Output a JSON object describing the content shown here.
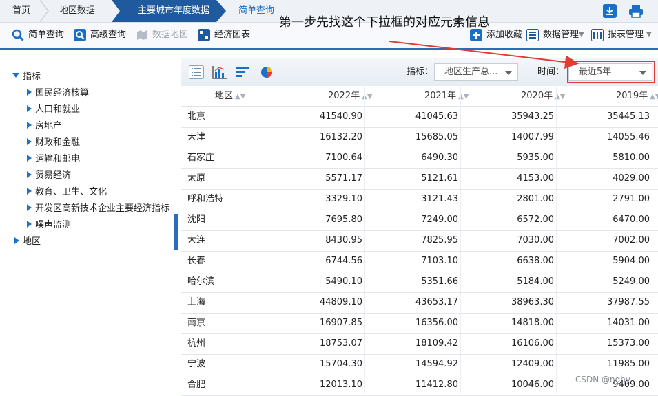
{
  "breadcrumb": {
    "items": [
      "首页",
      "地区数据"
    ],
    "active": "主要城市年度数据",
    "current": "简单查询"
  },
  "toolbar": {
    "simple_query": "简单查询",
    "advanced_query": "高级查询",
    "data_map": "数据地图",
    "economic_chart": "经济图表",
    "add_favorite": "添加收藏",
    "data_manage": "数据管理",
    "report_manage": "报表管理"
  },
  "annotation": "第一步先找这个下拉框的对应元素信息",
  "tree": {
    "root": "指标",
    "children": [
      "国民经济核算",
      "人口和就业",
      "房地产",
      "财政和金融",
      "运输和邮电",
      "贸易经济",
      "教育、卫生、文化",
      "开发区高新技术企业主要经济指标",
      "噪声监测"
    ],
    "second_root": "地区"
  },
  "filters": {
    "indicator_label": "指标：",
    "indicator_value": "地区生产总...",
    "time_label": "时间：",
    "time_value": "最近5年"
  },
  "table": {
    "headers": [
      "地区",
      "2022年",
      "2021年",
      "2020年",
      "2019年"
    ],
    "rows": [
      [
        "北京",
        "41540.90",
        "41045.63",
        "35943.25",
        "35445.13"
      ],
      [
        "天津",
        "16132.20",
        "15685.05",
        "14007.99",
        "14055.46"
      ],
      [
        "石家庄",
        "7100.64",
        "6490.30",
        "5935.00",
        "5810.00"
      ],
      [
        "太原",
        "5571.17",
        "5121.61",
        "4153.00",
        "4029.00"
      ],
      [
        "呼和浩特",
        "3329.10",
        "3121.43",
        "2801.00",
        "2791.00"
      ],
      [
        "沈阳",
        "7695.80",
        "7249.00",
        "6572.00",
        "6470.00"
      ],
      [
        "大连",
        "8430.95",
        "7825.95",
        "7030.00",
        "7002.00"
      ],
      [
        "长春",
        "6744.56",
        "7103.10",
        "6638.00",
        "5904.00"
      ],
      [
        "哈尔滨",
        "5490.10",
        "5351.66",
        "5184.00",
        "5249.00"
      ],
      [
        "上海",
        "44809.10",
        "43653.17",
        "38963.30",
        "37987.55"
      ],
      [
        "南京",
        "16907.85",
        "16356.00",
        "14818.00",
        "14031.00"
      ],
      [
        "杭州",
        "18753.07",
        "18109.42",
        "16106.00",
        "15373.00"
      ],
      [
        "宁波",
        "15704.30",
        "14594.92",
        "12409.00",
        "11985.00"
      ],
      [
        "合肥",
        "12013.10",
        "11412.80",
        "10046.00",
        "9409.00"
      ]
    ]
  },
  "watermark": "CSDN @nghy..",
  "colors": {
    "accent": "#2a6cb8",
    "highlight": "#e53935",
    "arrow": "#e53935"
  }
}
